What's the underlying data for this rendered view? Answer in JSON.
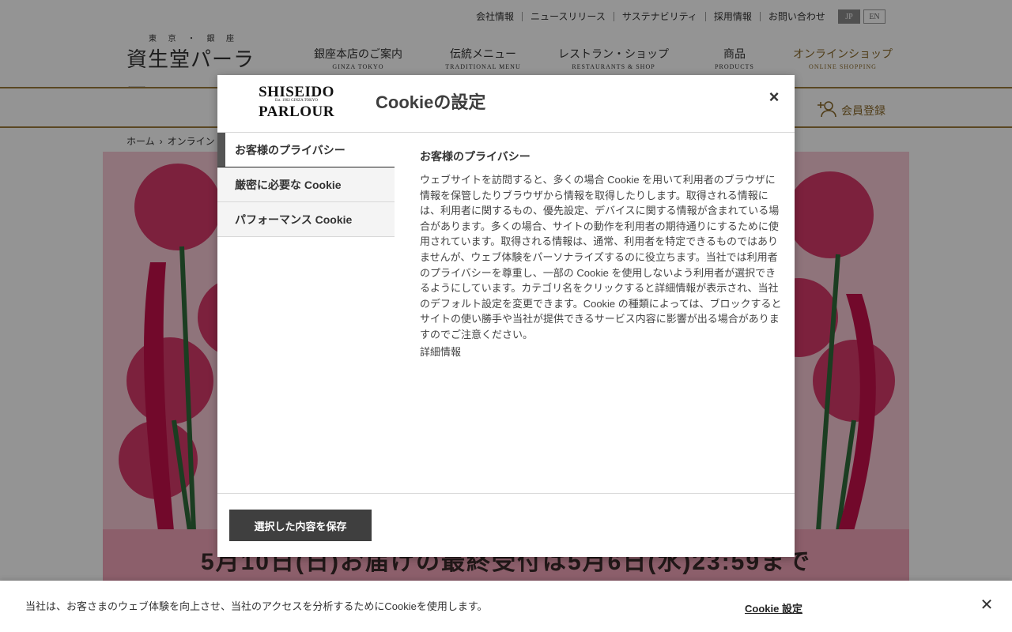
{
  "header": {
    "utility_links": [
      "会社情報",
      "ニュースリリース",
      "サステナビリティ",
      "採用情報",
      "お問い合わせ"
    ],
    "lang": {
      "jp": "JP",
      "en": "EN"
    },
    "logo_top": "東 京 ・ 銀 座",
    "logo_main": "資生堂パーラー",
    "nav": [
      {
        "jp": "銀座本店のご案内",
        "en": "GINZA TOKYO"
      },
      {
        "jp": "伝統メニュー",
        "en": "TRADITIONAL MENU"
      },
      {
        "jp": "レストラン・ショップ",
        "en": "RESTAURANTS & SHOP"
      },
      {
        "jp": "商品",
        "en": "PRODUCTS"
      },
      {
        "jp": "オンラインショップ",
        "en": "ONLINE SHOPPING"
      }
    ],
    "member_label": "会員登録"
  },
  "breadcrumb": {
    "home": "ホーム",
    "current": "オンライン"
  },
  "hero": {
    "text": "5月10日(日)お届けの最終受付は5月6日(水)23:59まで"
  },
  "modal": {
    "logo_line1": "SHISEIDO",
    "logo_line2": "PARLOUR",
    "logo_est": "Est. 1902 GINZA TOKYO",
    "title": "Cookieの設定",
    "close": "×",
    "tabs": [
      "お客様のプライバシー",
      "厳密に必要な Cookie",
      "パフォーマンス Cookie"
    ],
    "content_title": "お客様のプライバシー",
    "content_body": "ウェブサイトを訪問すると、多くの場合 Cookie を用いて利用者のブラウザに情報を保管したりブラウザから情報を取得したりします。取得される情報には、利用者に関するもの、優先設定、デバイスに関する情報が含まれている場合があります。多くの場合、サイトの動作を利用者の期待通りにするために使用されています。取得される情報は、通常、利用者を特定できるものではありませんが、ウェブ体験をパーソナライズするのに役立ちます。当社では利用者のプライバシーを尊重し、一部の Cookie を使用しないよう利用者が選択できるようにしています。カテゴリ名をクリックすると詳細情報が表示され、当社のデフォルト設定を変更できます。Cookie の種類によっては、ブロックするとサイトの使い勝手や当社が提供できるサービス内容に影響が出る場合がありますのでご注意ください。",
    "more_link": "詳細情報",
    "save_button": "選択した内容を保存"
  },
  "banner": {
    "text": "当社は、お客さまのウェブ体験を向上させ、当社のアクセスを分析するためにCookieを使用します。",
    "settings_link": "Cookie 設定",
    "close": "✕"
  }
}
